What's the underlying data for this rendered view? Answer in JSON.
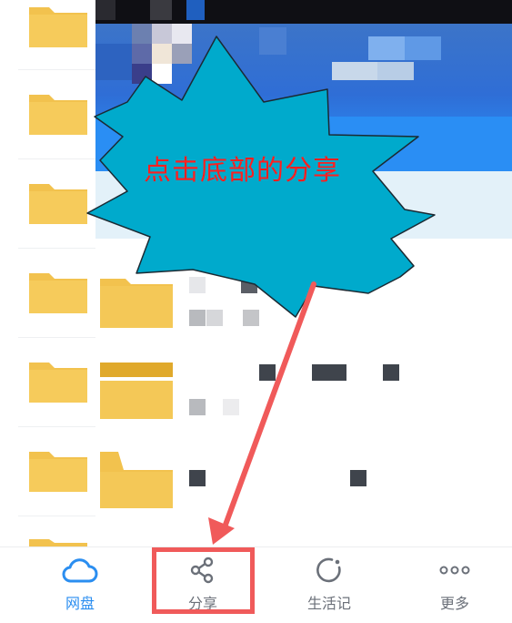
{
  "annotation": {
    "callout_text": "点击底部的分享",
    "callout_color": "#00aacc",
    "arrow_color": "#f05a5a"
  },
  "tabbar": {
    "tabs": [
      {
        "label": "网盘",
        "icon": "cloud-icon",
        "active": true
      },
      {
        "label": "分享",
        "icon": "share-icon",
        "active": false
      },
      {
        "label": "生活记",
        "icon": "refresh-circle-icon",
        "active": false
      },
      {
        "label": "更多",
        "icon": "more-dots-icon",
        "active": false
      }
    ],
    "active_color": "#2b8ef0",
    "inactive_color": "#6b7079"
  },
  "colors": {
    "folder": "#f2c24e",
    "folder_dark": "#e0a92b",
    "banner_blue": "#2f6ed6"
  }
}
